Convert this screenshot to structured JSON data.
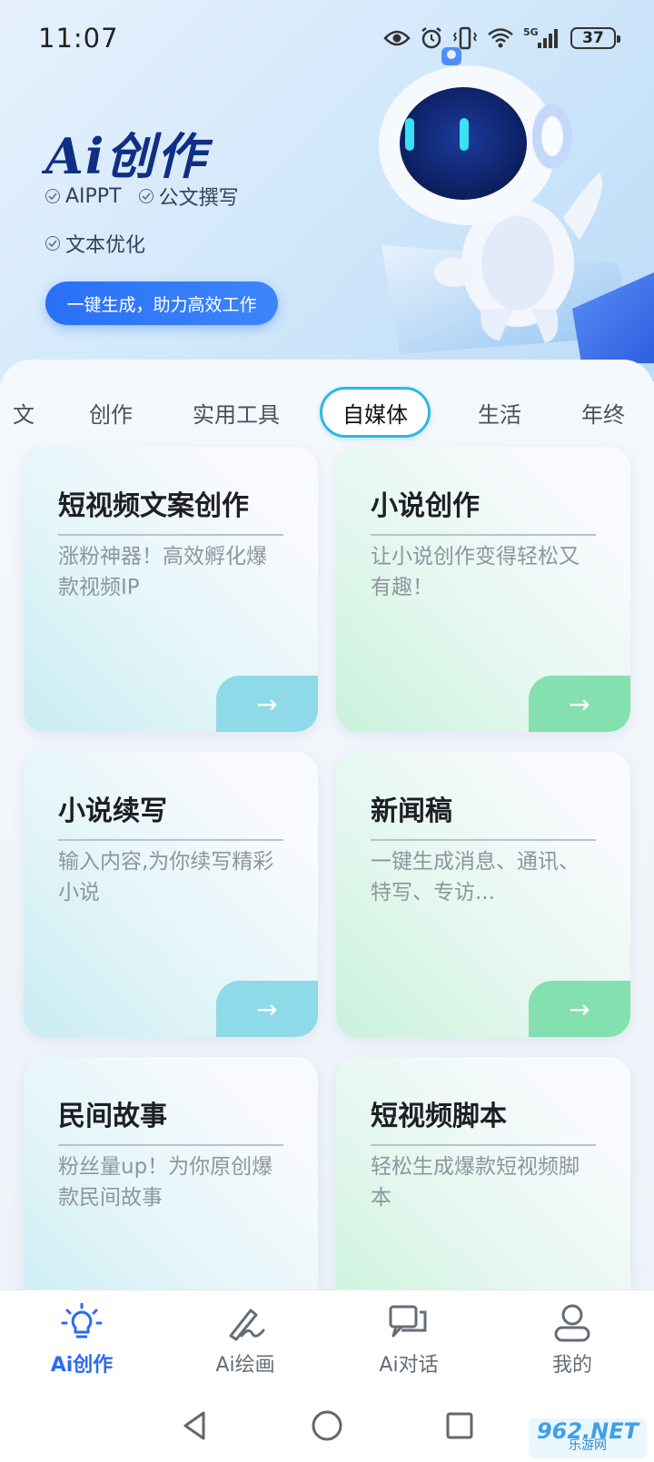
{
  "status_bar": {
    "time": "11:07",
    "battery": "37",
    "icons": [
      "eye-icon",
      "alarm-icon",
      "vibrate-icon",
      "wifi-icon",
      "signal-5g-icon"
    ],
    "network_label": "5G"
  },
  "hero": {
    "title": "Ai创作",
    "features": [
      "AIPPT",
      "公文撰写",
      "文本优化"
    ],
    "cta_label": "一键生成，助力高效工作"
  },
  "tabs": [
    {
      "label": "文"
    },
    {
      "label": "创作"
    },
    {
      "label": "实用工具"
    },
    {
      "label": "自媒体",
      "active": true
    },
    {
      "label": "生活"
    },
    {
      "label": "年终"
    }
  ],
  "cards": [
    {
      "title": "短视频文案创作",
      "desc": "涨粉神器！高效孵化爆款视频IP",
      "theme": "blue"
    },
    {
      "title": "小说创作",
      "desc": "让小说创作变得轻松又有趣！",
      "theme": "green"
    },
    {
      "title": "小说续写",
      "desc": "输入内容,为你续写精彩小说",
      "theme": "blue"
    },
    {
      "title": "新闻稿",
      "desc": "一键生成消息、通讯、特写、专访...",
      "theme": "green"
    },
    {
      "title": "民间故事",
      "desc": "粉丝量up！为你原创爆款民间故事",
      "theme": "blue"
    },
    {
      "title": "短视频脚本",
      "desc": "轻松生成爆款短视频脚本",
      "theme": "green"
    }
  ],
  "arrow_glyph": "→",
  "bottom_nav": [
    {
      "label": "Ai创作",
      "icon": "bulb-icon",
      "active": true
    },
    {
      "label": "Ai绘画",
      "icon": "pen-icon"
    },
    {
      "label": "Ai对话",
      "icon": "chat-icon"
    },
    {
      "label": "我的",
      "icon": "user-icon"
    }
  ],
  "watermark": {
    "big": "962.NET",
    "small": "乐游网"
  },
  "colors": {
    "accent": "#2a6bf3",
    "tab_active_border": "#2bb8e8",
    "brand_title": "#0f2f86",
    "card_blue_arrow": "#8fdae9",
    "card_green_arrow": "#84e0ae"
  }
}
